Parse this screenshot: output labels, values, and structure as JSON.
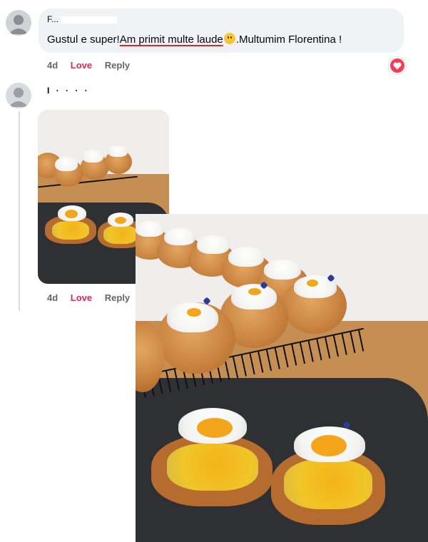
{
  "comment1": {
    "author_fragment": "F...",
    "text_before": "Gustul e super!",
    "text_underlined": "Am primit multe laude",
    "text_after": ".Multumim Florentina !",
    "time": "4d",
    "love_label": "Love",
    "reply_label": "Reply"
  },
  "comment2": {
    "author_fragment": "I · · · ·",
    "time": "4d",
    "love_label": "Love",
    "reply_label": "Reply"
  },
  "colors": {
    "love": "#e0245e",
    "bubble": "#f0f2f5",
    "reaction": "#f33e58"
  },
  "icons": {
    "reaction": "heart-icon",
    "emoji": "smiling-face-icon"
  }
}
